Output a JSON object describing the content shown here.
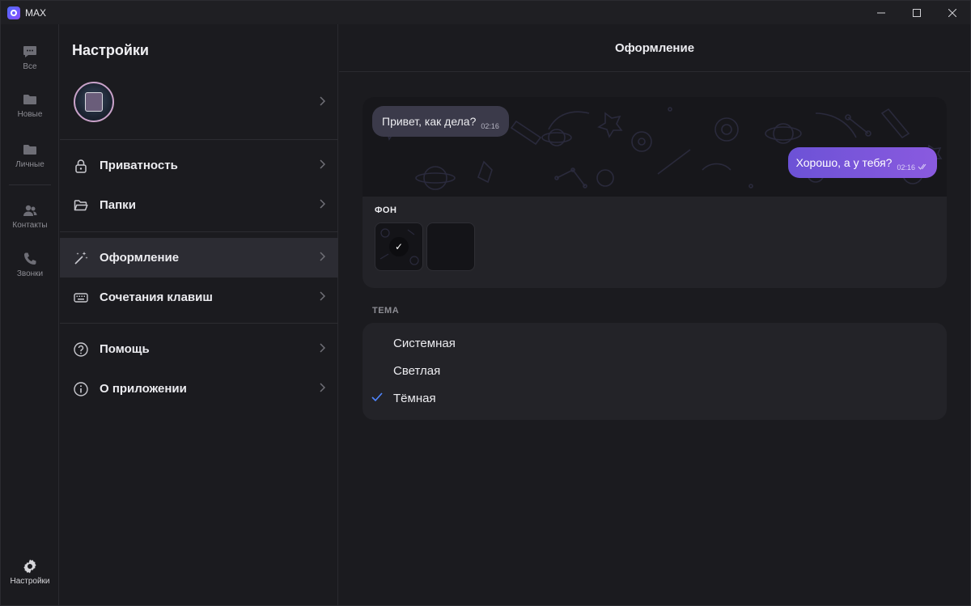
{
  "window": {
    "title": "MAX"
  },
  "rail": {
    "items": [
      {
        "label": "Все",
        "icon": "chat-bubble-icon"
      },
      {
        "label": "Новые",
        "icon": "folder-icon"
      },
      {
        "label": "Личные",
        "icon": "folder-icon"
      },
      {
        "label": "Контакты",
        "icon": "contacts-icon"
      },
      {
        "label": "Звонки",
        "icon": "phone-icon"
      }
    ],
    "settings_label": "Настройки"
  },
  "settings": {
    "title": "Настройки",
    "menu": [
      {
        "label": "Приватность",
        "icon": "lock-icon"
      },
      {
        "label": "Папки",
        "icon": "folder-open-icon"
      },
      {
        "label": "Оформление",
        "icon": "magic-wand-icon",
        "active": true
      },
      {
        "label": "Сочетания клавиш",
        "icon": "keyboard-icon"
      },
      {
        "label": "Помощь",
        "icon": "help-icon"
      },
      {
        "label": "О приложении",
        "icon": "info-icon"
      }
    ]
  },
  "pane": {
    "title": "Оформление",
    "preview": {
      "incoming": {
        "text": "Привет, как дела?",
        "time": "02:16"
      },
      "outgoing": {
        "text": "Хорошо, а у тебя?",
        "time": "02:16"
      }
    },
    "background_label": "ФОН",
    "theme_label": "ТЕМА",
    "themes": [
      {
        "label": "Системная",
        "selected": false
      },
      {
        "label": "Светлая",
        "selected": false
      },
      {
        "label": "Тёмная",
        "selected": true
      }
    ]
  },
  "colors": {
    "accent": "#4f86ff",
    "bubble_out_start": "#6c52d6",
    "bubble_out_end": "#8a5adf",
    "bubble_in": "#3b3a4a"
  }
}
